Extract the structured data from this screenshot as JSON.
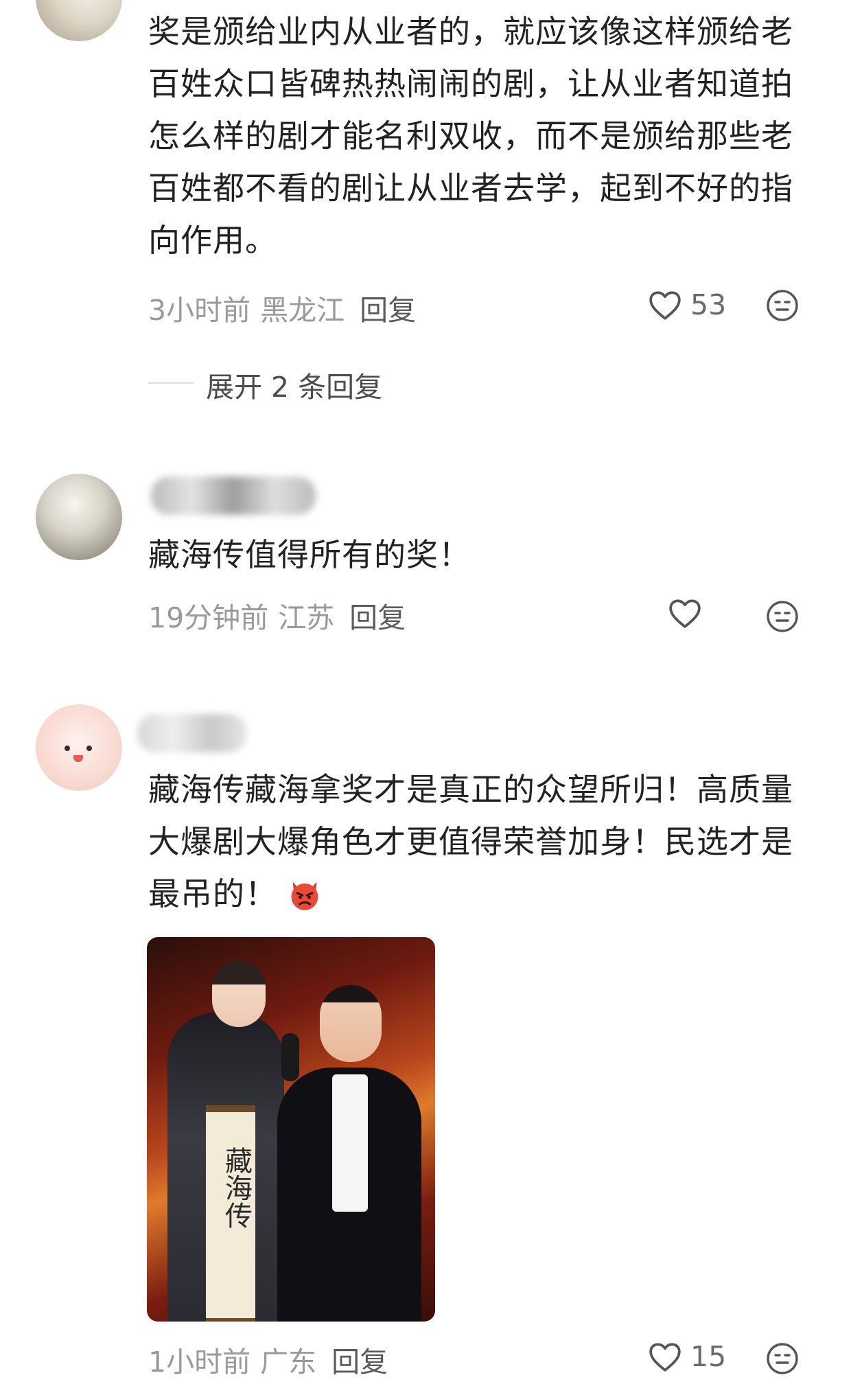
{
  "comments": [
    {
      "text": "奖是颁给业内从业者的，就应该像这样颁给老百姓众口皆碑热热闹闹的剧，让从业者知道拍怎么样的剧才能名利双收，而不是颁给那些老百姓都不看的剧让从业者去学，起到不好的指向作用。",
      "time": "3小时前",
      "location": "黑龙江",
      "reply_label": "回复",
      "likes": "53",
      "expand_label": "展开 2 条回复"
    },
    {
      "text": "藏海传值得所有的奖！",
      "time": "19分钟前",
      "location": "江苏",
      "reply_label": "回复",
      "likes": ""
    },
    {
      "text": "藏海传藏海拿奖才是真正的众望所归！高质量大爆剧大爆角色才更值得荣誉加身！民选才是最吊的！",
      "time": "1小时前",
      "location": "广东",
      "reply_label": "回复",
      "likes": "15",
      "image_text": "藏海传"
    }
  ],
  "icons": {
    "like": "heart-outline-icon",
    "emoji": "neutral-face-icon",
    "inline_emoji": "angry-devil-emoji"
  },
  "colors": {
    "text": "#222222",
    "meta": "#9a9a9a",
    "reply": "#5b5b5b",
    "emoji_red": "#e84a3a"
  }
}
